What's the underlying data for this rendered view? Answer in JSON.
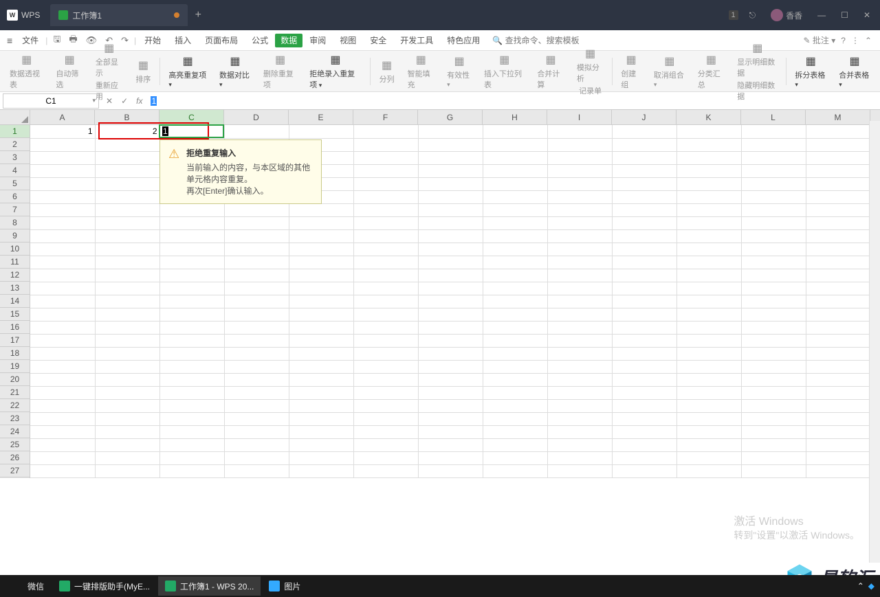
{
  "titlebar": {
    "app": "WPS",
    "tab_name": "工作簿1",
    "matrix_badge": "1",
    "user": "香香"
  },
  "menubar": {
    "file": "文件",
    "items": [
      "开始",
      "插入",
      "页面布局",
      "公式",
      "数据",
      "审阅",
      "视图",
      "安全",
      "开发工具",
      "特色应用"
    ],
    "active_index": 4,
    "search": "查找命令、搜索模板",
    "annot": "批注"
  },
  "ribbon": {
    "items": [
      {
        "label": "数据透视表",
        "enabled": false
      },
      {
        "label": "自动筛选",
        "enabled": false
      },
      {
        "label": "全部显示",
        "enabled": false,
        "sub": "重新应用"
      },
      {
        "label": "排序",
        "enabled": false
      },
      {
        "label": "高亮重复项",
        "enabled": true,
        "dd": true
      },
      {
        "label": "数据对比",
        "enabled": true,
        "dd": true
      },
      {
        "label": "删除重复项",
        "enabled": false
      },
      {
        "label": "拒绝录入重复项",
        "enabled": true,
        "dd": true
      },
      {
        "label": "分列",
        "enabled": false
      },
      {
        "label": "智能填充",
        "enabled": false
      },
      {
        "label": "有效性",
        "enabled": false,
        "dd": true
      },
      {
        "label": "插入下拉列表",
        "enabled": false
      },
      {
        "label": "合并计算",
        "enabled": false
      },
      {
        "label": "模拟分析",
        "enabled": false,
        "sub": "记录单"
      },
      {
        "label": "创建组",
        "enabled": false
      },
      {
        "label": "取消组合",
        "enabled": false,
        "dd": true
      },
      {
        "label": "分类汇总",
        "enabled": false
      },
      {
        "label": "显示明细数据",
        "enabled": false,
        "sub": "隐藏明细数据"
      },
      {
        "label": "拆分表格",
        "enabled": true,
        "dd": true
      },
      {
        "label": "合并表格",
        "enabled": true,
        "dd": true
      }
    ]
  },
  "formula_bar": {
    "name_box": "C1",
    "formula": "1"
  },
  "grid": {
    "cols": [
      "A",
      "B",
      "C",
      "D",
      "E",
      "F",
      "G",
      "H",
      "I",
      "J",
      "K",
      "L",
      "M"
    ],
    "active_col": "C",
    "active_row": 1,
    "row_count": 27,
    "data": {
      "A1": "1",
      "B1": "2",
      "C1": "1"
    }
  },
  "tooltip": {
    "title": "拒绝重复输入",
    "line1": "当前输入的内容，与本区域的其他单元格内容重复。",
    "line2": "再次[Enter]确认输入。"
  },
  "watermark": {
    "title": "激活 Windows",
    "sub": "转到\"设置\"以激活 Windows。"
  },
  "brand": "易软汇",
  "taskbar": {
    "items": [
      {
        "label": "微信",
        "color": "#1a1a1a"
      },
      {
        "label": "一键排版助手(MyE...",
        "color": "#2a6"
      },
      {
        "label": "工作簿1 - WPS 20...",
        "color": "#2a6",
        "active": true
      },
      {
        "label": "图片",
        "color": "#3af"
      }
    ]
  }
}
